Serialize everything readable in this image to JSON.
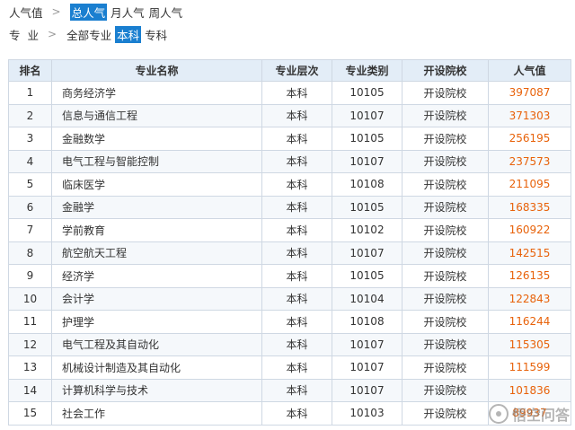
{
  "filters": {
    "popularity": {
      "label": "人气值",
      "options": [
        {
          "label": "总人气",
          "active": true
        },
        {
          "label": "月人气",
          "active": false
        },
        {
          "label": "周人气",
          "active": false
        }
      ]
    },
    "major": {
      "label": "专业",
      "options": [
        {
          "label": "全部专业",
          "active": false
        },
        {
          "label": "本科",
          "active": true
        },
        {
          "label": "专科",
          "active": false
        }
      ]
    }
  },
  "table": {
    "headers": [
      "排名",
      "专业名称",
      "专业层次",
      "专业类别",
      "开设院校",
      "人气值"
    ],
    "rows": [
      [
        "1",
        "商务经济学",
        "本科",
        "10105",
        "开设院校",
        "397087"
      ],
      [
        "2",
        "信息与通信工程",
        "本科",
        "10107",
        "开设院校",
        "371303"
      ],
      [
        "3",
        "金融数学",
        "本科",
        "10105",
        "开设院校",
        "256195"
      ],
      [
        "4",
        "电气工程与智能控制",
        "本科",
        "10107",
        "开设院校",
        "237573"
      ],
      [
        "5",
        "临床医学",
        "本科",
        "10108",
        "开设院校",
        "211095"
      ],
      [
        "6",
        "金融学",
        "本科",
        "10105",
        "开设院校",
        "168335"
      ],
      [
        "7",
        "学前教育",
        "本科",
        "10102",
        "开设院校",
        "160922"
      ],
      [
        "8",
        "航空航天工程",
        "本科",
        "10107",
        "开设院校",
        "142515"
      ],
      [
        "9",
        "经济学",
        "本科",
        "10105",
        "开设院校",
        "126135"
      ],
      [
        "10",
        "会计学",
        "本科",
        "10104",
        "开设院校",
        "122843"
      ],
      [
        "11",
        "护理学",
        "本科",
        "10108",
        "开设院校",
        "116244"
      ],
      [
        "12",
        "电气工程及其自动化",
        "本科",
        "10107",
        "开设院校",
        "115305"
      ],
      [
        "13",
        "机械设计制造及其自动化",
        "本科",
        "10107",
        "开设院校",
        "111599"
      ],
      [
        "14",
        "计算机科学与技术",
        "本科",
        "10107",
        "开设院校",
        "101836"
      ],
      [
        "15",
        "社会工作",
        "本科",
        "10103",
        "开设院校",
        "89937"
      ]
    ]
  },
  "watermark": {
    "text": "悟空问答"
  },
  "colors": {
    "accent": "#1a7fd0",
    "popularity_value": "#e8620a",
    "header_bg": "#e3edf7",
    "border": "#cfd8e3"
  }
}
